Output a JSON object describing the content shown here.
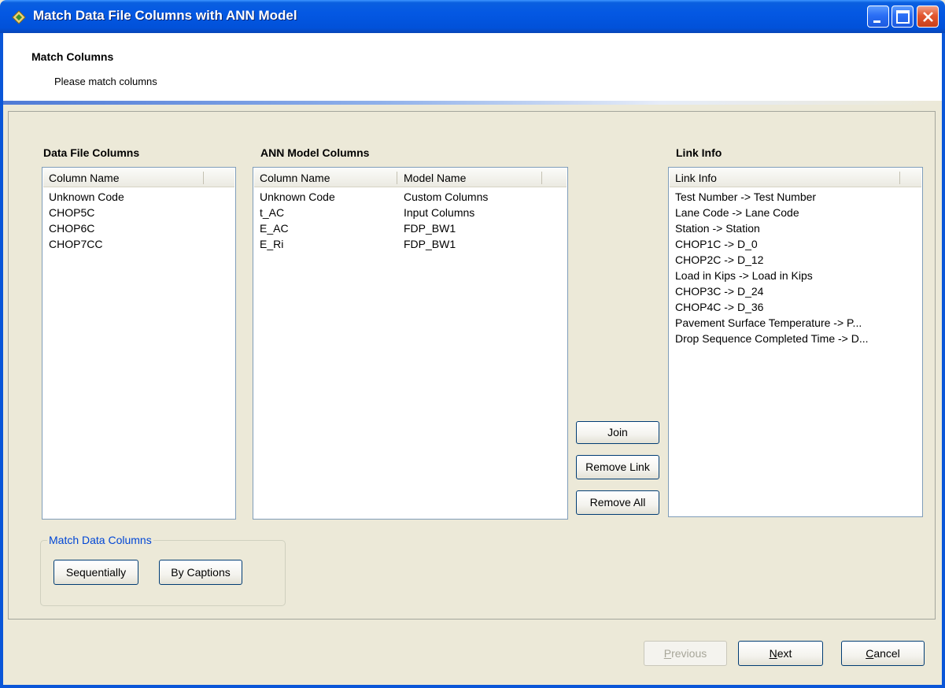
{
  "window": {
    "title": "Match Data File Columns with ANN Model",
    "minimize_icon": "minimize-icon",
    "maximize_icon": "maximize-icon",
    "close_icon": "close-icon",
    "app_icon": "app-icon"
  },
  "header": {
    "title": "Match Columns",
    "subtitle": "Please match columns"
  },
  "data_file": {
    "label": "Data File Columns",
    "columns": [
      "Column Name"
    ],
    "rows": [
      "Unknown Code",
      "CHOP5C",
      "CHOP6C",
      "CHOP7CC"
    ]
  },
  "ann_model": {
    "label": "ANN Model Columns",
    "columns": [
      "Column Name",
      "Model Name"
    ],
    "rows": [
      [
        "Unknown Code",
        "Custom Columns"
      ],
      [
        "t_AC",
        "Input Columns"
      ],
      [
        "E_AC",
        "FDP_BW1"
      ],
      [
        "E_Ri",
        "FDP_BW1"
      ]
    ]
  },
  "link_info": {
    "label": "Link Info",
    "columns": [
      "Link Info"
    ],
    "rows": [
      "Test Number -> Test Number",
      "Lane Code -> Lane Code",
      "Station -> Station",
      "CHOP1C -> D_0",
      "CHOP2C -> D_12",
      "Load in Kips -> Load in Kips",
      "CHOP3C -> D_24",
      "CHOP4C -> D_36",
      "Pavement Surface Temperature  -> P...",
      "Drop Sequence Completed Time -> D..."
    ]
  },
  "actions": {
    "join": "Join",
    "remove_link": "Remove Link",
    "remove_all": "Remove All"
  },
  "match_group": {
    "legend": "Match Data Columns",
    "sequentially": "Sequentially",
    "by_captions": "By Captions"
  },
  "footer": {
    "previous": "Previous",
    "next": "Next",
    "cancel": "Cancel"
  },
  "colors": {
    "titlebar": "#0458e3",
    "list_border": "#7f9db9",
    "group_legend": "#0046d5",
    "face": "#ece9d8"
  }
}
